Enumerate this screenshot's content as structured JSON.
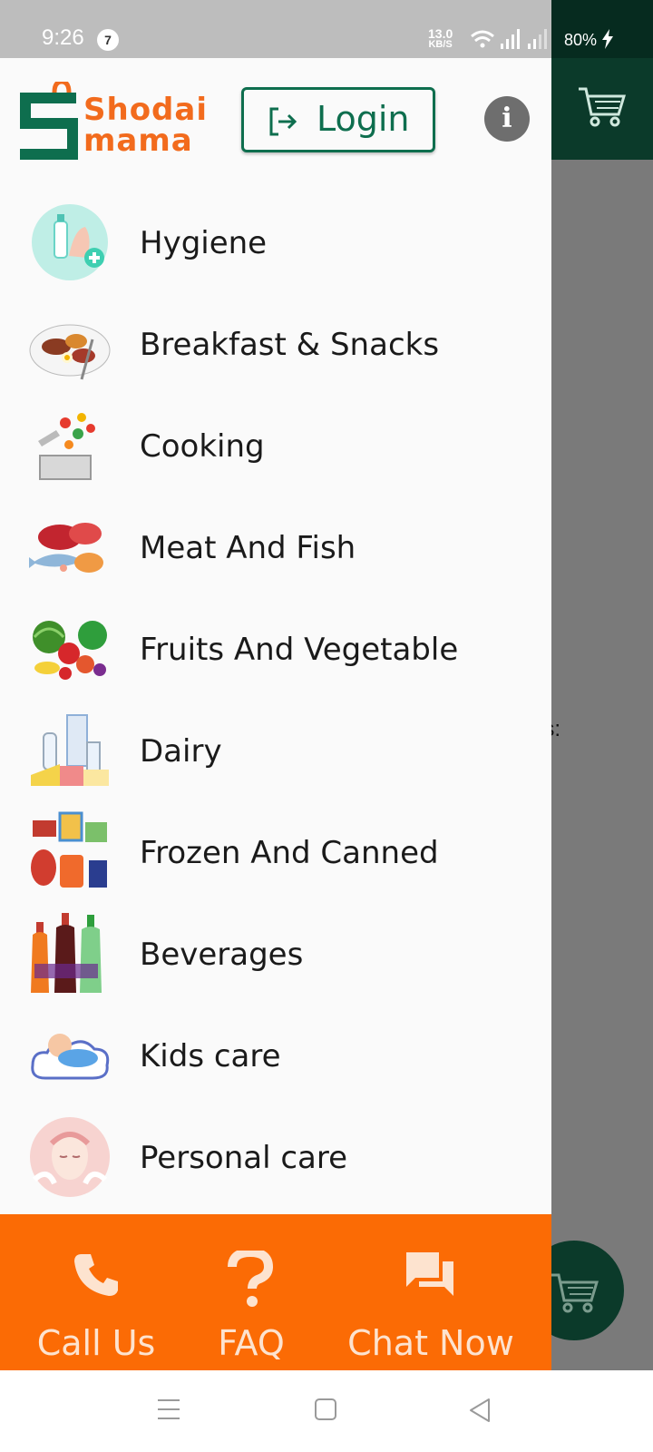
{
  "status_bar": {
    "time": "9:26",
    "notification_count": "7",
    "net_speed_value": "13.0",
    "net_speed_unit": "KB/S",
    "battery": "80%"
  },
  "background": {
    "partial_text": "es:"
  },
  "drawer": {
    "logo": {
      "line1": "Shodai",
      "line2": "mama"
    },
    "login_label": "Login",
    "categories": [
      {
        "label": "Hygiene",
        "icon": "hygiene-icon"
      },
      {
        "label": "Breakfast & Snacks",
        "icon": "breakfast-icon"
      },
      {
        "label": "Cooking",
        "icon": "cooking-icon"
      },
      {
        "label": "Meat And Fish",
        "icon": "meat-fish-icon"
      },
      {
        "label": "Fruits And Vegetable",
        "icon": "fruits-vegetable-icon"
      },
      {
        "label": "Dairy",
        "icon": "dairy-icon"
      },
      {
        "label": "Frozen And Canned",
        "icon": "frozen-canned-icon"
      },
      {
        "label": "Beverages",
        "icon": "beverages-icon"
      },
      {
        "label": "Kids care",
        "icon": "kids-care-icon"
      },
      {
        "label": "Personal care",
        "icon": "personal-care-icon"
      }
    ]
  },
  "actions": {
    "call": "Call Us",
    "faq": "FAQ",
    "chat": "Chat Now"
  },
  "colors": {
    "brand_green": "#0e6e4e",
    "brand_orange": "#f26b1d",
    "action_bar": "#fb6b05",
    "dark_green": "#0b3a2a"
  }
}
